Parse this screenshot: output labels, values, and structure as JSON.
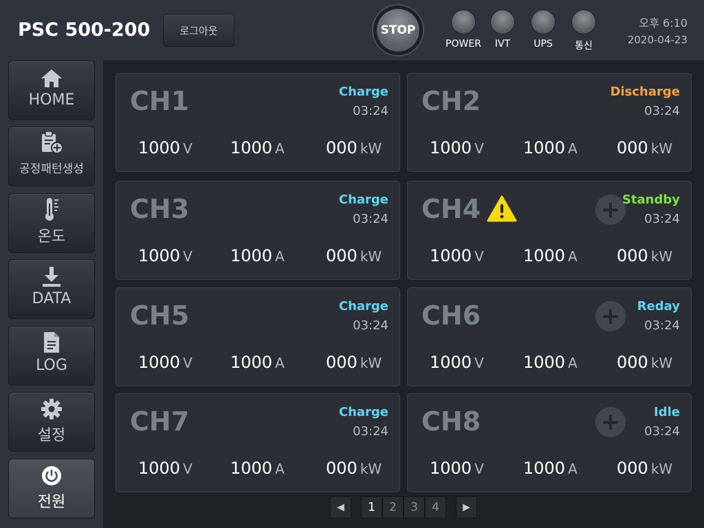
{
  "header": {
    "title": "PSC 500-200",
    "logout_label": "로그아웃",
    "stop_label": "STOP",
    "indicators": [
      {
        "label": "POWER"
      },
      {
        "label": "IVT"
      },
      {
        "label": "UPS"
      },
      {
        "label": "통신"
      }
    ],
    "time": "오후 6:10",
    "date": "2020-04-23"
  },
  "sidebar": {
    "items": [
      {
        "label": "HOME",
        "icon": "home-icon"
      },
      {
        "label": "공정패턴생성",
        "icon": "clipboard-plus-icon"
      },
      {
        "label": "온도",
        "icon": "thermometer-icon"
      },
      {
        "label": "DATA",
        "icon": "download-icon"
      },
      {
        "label": "LOG",
        "icon": "document-icon"
      },
      {
        "label": "설정",
        "icon": "gear-icon"
      },
      {
        "label": "전원",
        "icon": "power-icon"
      }
    ]
  },
  "channels": [
    {
      "name": "CH1",
      "status": "Charge",
      "status_color": "#5fd3f3",
      "time": "03:24",
      "voltage": "1000",
      "v_unit": "V",
      "current": "1000",
      "a_unit": "A",
      "power": "000",
      "kw_unit": "kW"
    },
    {
      "name": "CH2",
      "status": "Discharge",
      "status_color": "#f5a23a",
      "time": "03:24",
      "voltage": "1000",
      "v_unit": "V",
      "current": "1000",
      "a_unit": "A",
      "power": "000",
      "kw_unit": "kW"
    },
    {
      "name": "CH3",
      "status": "Charge",
      "status_color": "#5fd3f3",
      "time": "03:24",
      "voltage": "1000",
      "v_unit": "V",
      "current": "1000",
      "a_unit": "A",
      "power": "000",
      "kw_unit": "kW"
    },
    {
      "name": "CH4",
      "status": "Standby",
      "status_color": "#7ee23c",
      "time": "03:24",
      "voltage": "1000",
      "v_unit": "V",
      "current": "1000",
      "a_unit": "A",
      "power": "000",
      "kw_unit": "kW",
      "warning": true
    },
    {
      "name": "CH5",
      "status": "Charge",
      "status_color": "#5fd3f3",
      "time": "03:24",
      "voltage": "1000",
      "v_unit": "V",
      "current": "1000",
      "a_unit": "A",
      "power": "000",
      "kw_unit": "kW"
    },
    {
      "name": "CH6",
      "status": "Reday",
      "status_color": "#5fd3f3",
      "time": "03:24",
      "voltage": "1000",
      "v_unit": "V",
      "current": "1000",
      "a_unit": "A",
      "power": "000",
      "kw_unit": "kW"
    },
    {
      "name": "CH7",
      "status": "Charge",
      "status_color": "#5fd3f3",
      "time": "03:24",
      "voltage": "1000",
      "v_unit": "V",
      "current": "1000",
      "a_unit": "A",
      "power": "000",
      "kw_unit": "kW"
    },
    {
      "name": "CH8",
      "status": "Idle",
      "status_color": "#5fd3f3",
      "time": "03:24",
      "voltage": "1000",
      "v_unit": "V",
      "current": "1000",
      "a_unit": "A",
      "power": "000",
      "kw_unit": "kW"
    }
  ],
  "pagination": {
    "prev": "◀",
    "pages": [
      "1",
      "2",
      "3",
      "4"
    ],
    "current": "1",
    "next": "▶"
  }
}
